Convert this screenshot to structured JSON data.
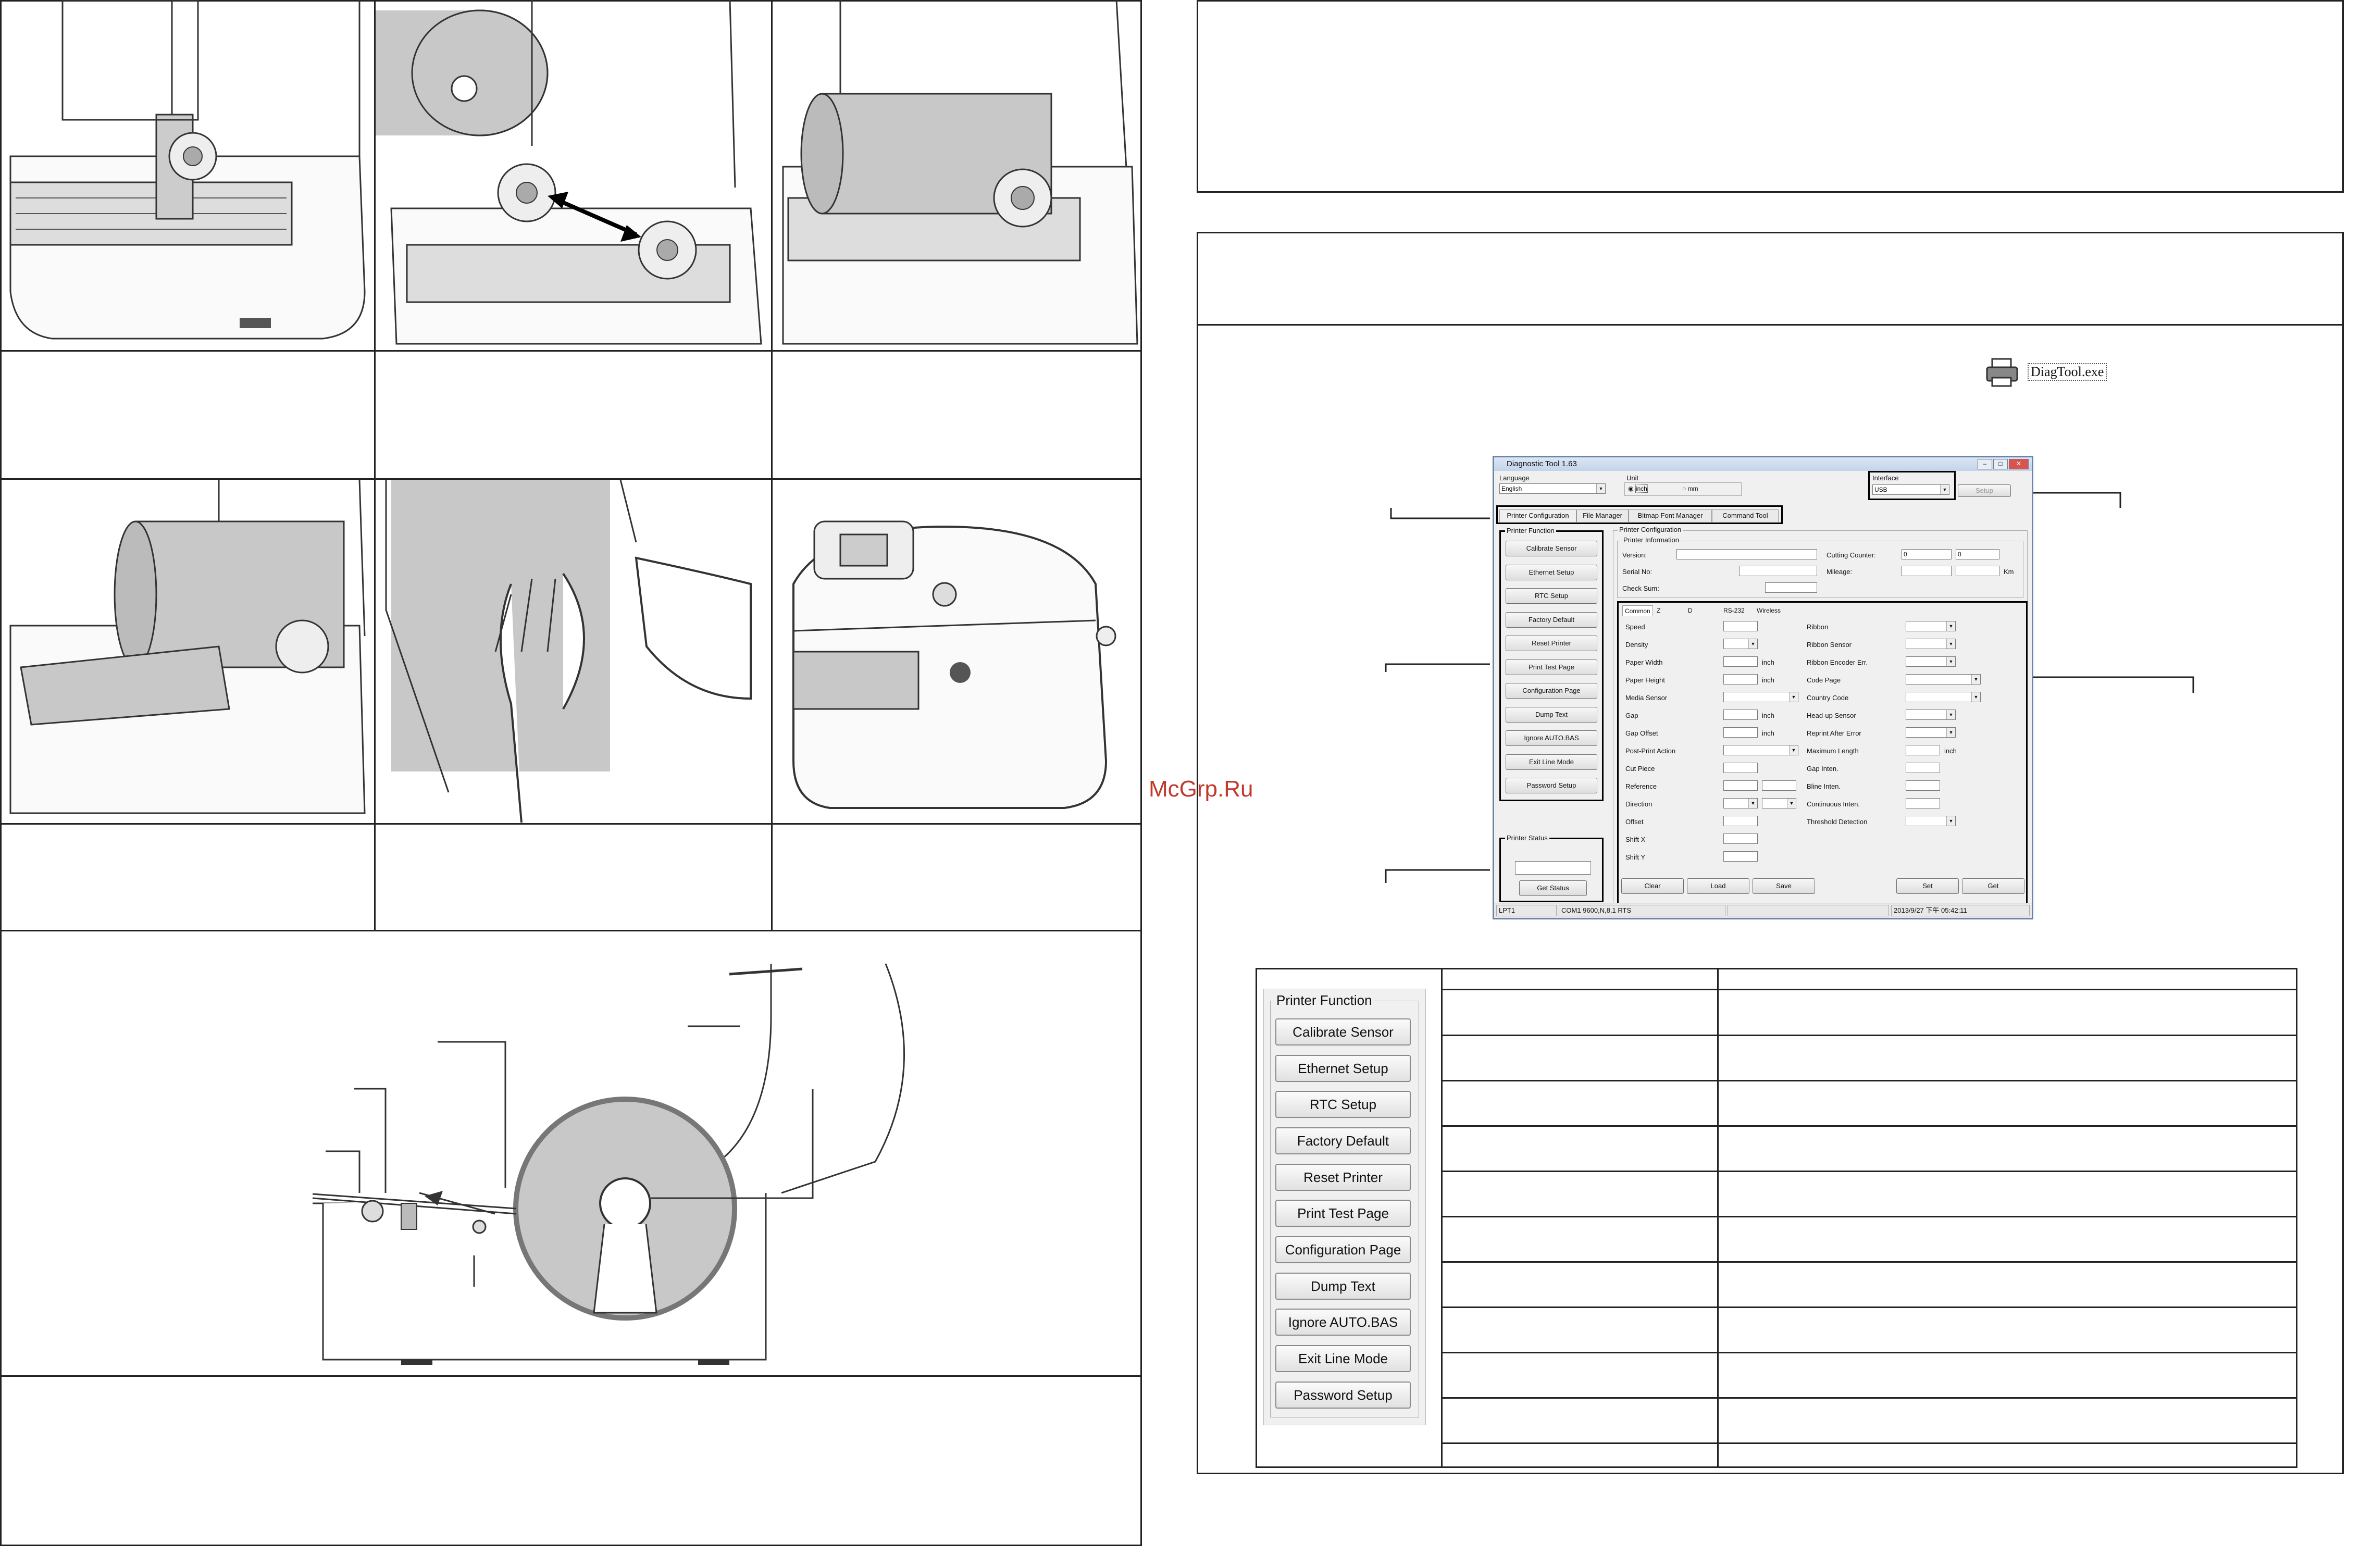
{
  "watermark": "McGrp.Ru",
  "file_icon": {
    "name": "printer-icon",
    "label": "DiagTool.exe"
  },
  "diag_tool": {
    "title": "Diagnostic Tool 1.63",
    "language_label": "Language",
    "language_value": "English",
    "unit_label": "Unit",
    "unit_inch": "inch",
    "unit_mm": "mm",
    "interface_label": "Interface",
    "interface_value": "USB",
    "setup_button": "Setup",
    "tabs": [
      "Printer Configuration",
      "File Manager",
      "Bitmap Font Manager",
      "Command Tool"
    ],
    "printer_function_title": "Printer Function",
    "function_buttons": [
      "Calibrate Sensor",
      "Ethernet Setup",
      "RTC Setup",
      "Factory Default",
      "Reset Printer",
      "Print Test Page",
      "Configuration Page",
      "Dump Text",
      "Ignore AUTO.BAS",
      "Exit Line Mode",
      "Password Setup"
    ],
    "printer_status_title": "Printer Status",
    "get_status": "Get Status",
    "config_title": "Printer Configuration",
    "info_title": "Printer Information",
    "version_label": "Version:",
    "serial_label": "Serial No:",
    "checksum_label": "Check Sum:",
    "cutting_label": "Cutting Counter:",
    "cutting_values": [
      "0",
      "0"
    ],
    "mileage_label": "Mileage:",
    "mileage_unit": "Km",
    "sub_tabs": [
      "Common",
      "Z",
      "D",
      "RS-232",
      "Wireless"
    ],
    "left_fields": [
      "Speed",
      "Density",
      "Paper Width",
      "Paper Height",
      "Media Sensor",
      "Gap",
      "Gap Offset",
      "Post-Print Action",
      "Cut Piece",
      "Reference",
      "Direction",
      "Offset",
      "Shift X",
      "Shift Y"
    ],
    "right_fields": [
      "Ribbon",
      "Ribbon Sensor",
      "Ribbon Encoder Err.",
      "Code Page",
      "Country Code",
      "Head-up Sensor",
      "Reprint After Error",
      "Maximum Length",
      "Gap Inten.",
      "Bline Inten.",
      "Continuous Inten.",
      "Threshold Detection"
    ],
    "inch_unit": "inch",
    "bottom_buttons": [
      "Clear",
      "Load",
      "Save",
      "Set",
      "Get"
    ],
    "status_port": "LPT1",
    "status_com": "COM1 9600,N,8,1 RTS",
    "status_time": "2013/9/27 下午 05:42:11"
  },
  "printer_function_panel": {
    "title": "Printer Function",
    "buttons": [
      "Calibrate Sensor",
      "Ethernet Setup",
      "RTC Setup",
      "Factory Default",
      "Reset Printer",
      "Print Test Page",
      "Configuration Page",
      "Dump Text",
      "Ignore AUTO.BAS",
      "Exit Line Mode",
      "Password Setup"
    ]
  }
}
